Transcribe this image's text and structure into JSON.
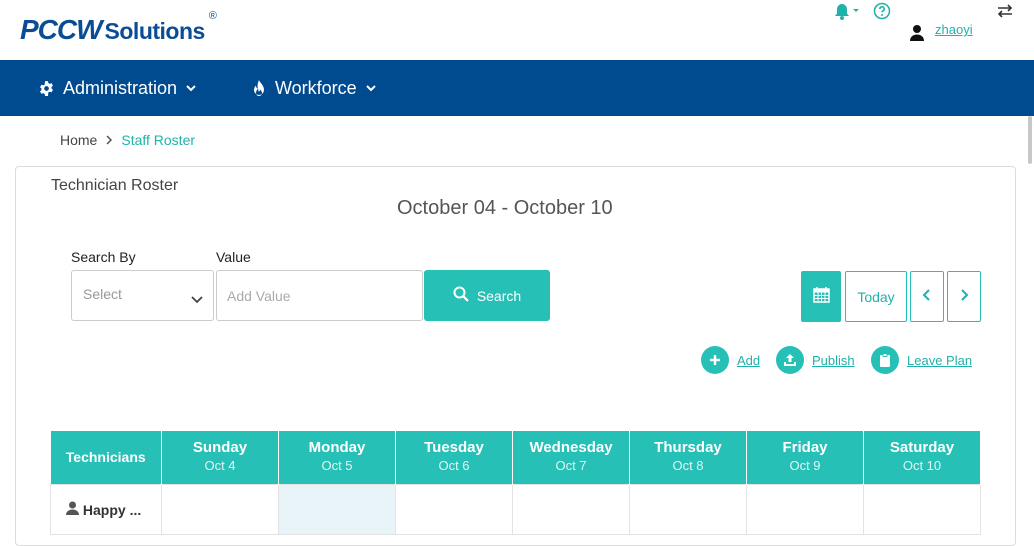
{
  "brand": {
    "name_bold": "PCCW",
    "name_rest": "Solutions",
    "reg": "®",
    "color": "#0b4d95"
  },
  "topbar": {
    "username": "zhaoyi",
    "icons": [
      "bell-icon",
      "help-icon",
      "user-icon",
      "swap-icon"
    ]
  },
  "nav": {
    "items": [
      {
        "label": "Administration",
        "icon": "gear-icon"
      },
      {
        "label": "Workforce",
        "icon": "fire-icon"
      }
    ]
  },
  "breadcrumb": {
    "home": "Home",
    "current": "Staff Roster"
  },
  "roster": {
    "title": "Technician Roster",
    "date_range": "October 04 - October 10",
    "search": {
      "search_by_label": "Search By",
      "search_by_value": "Select",
      "value_label": "Value",
      "value_placeholder": "Add Value",
      "button_label": "Search"
    },
    "controls": {
      "today": "Today"
    },
    "actions": [
      {
        "label": "Add",
        "icon": "plus-icon"
      },
      {
        "label": "Publish",
        "icon": "upload-icon"
      },
      {
        "label": "Leave Plan",
        "icon": "clipboard-icon"
      }
    ],
    "table": {
      "tech_header": "Technicians",
      "days": [
        {
          "name": "Sunday",
          "date": "Oct 4"
        },
        {
          "name": "Monday",
          "date": "Oct 5"
        },
        {
          "name": "Tuesday",
          "date": "Oct 6"
        },
        {
          "name": "Wednesday",
          "date": "Oct 7"
        },
        {
          "name": "Thursday",
          "date": "Oct 8"
        },
        {
          "name": "Friday",
          "date": "Oct 9"
        },
        {
          "name": "Saturday",
          "date": "Oct 10"
        }
      ],
      "rows": [
        {
          "technician": "Happy ..."
        }
      ]
    }
  },
  "colors": {
    "accent": "#26c0b7",
    "nav": "#004a8f"
  }
}
